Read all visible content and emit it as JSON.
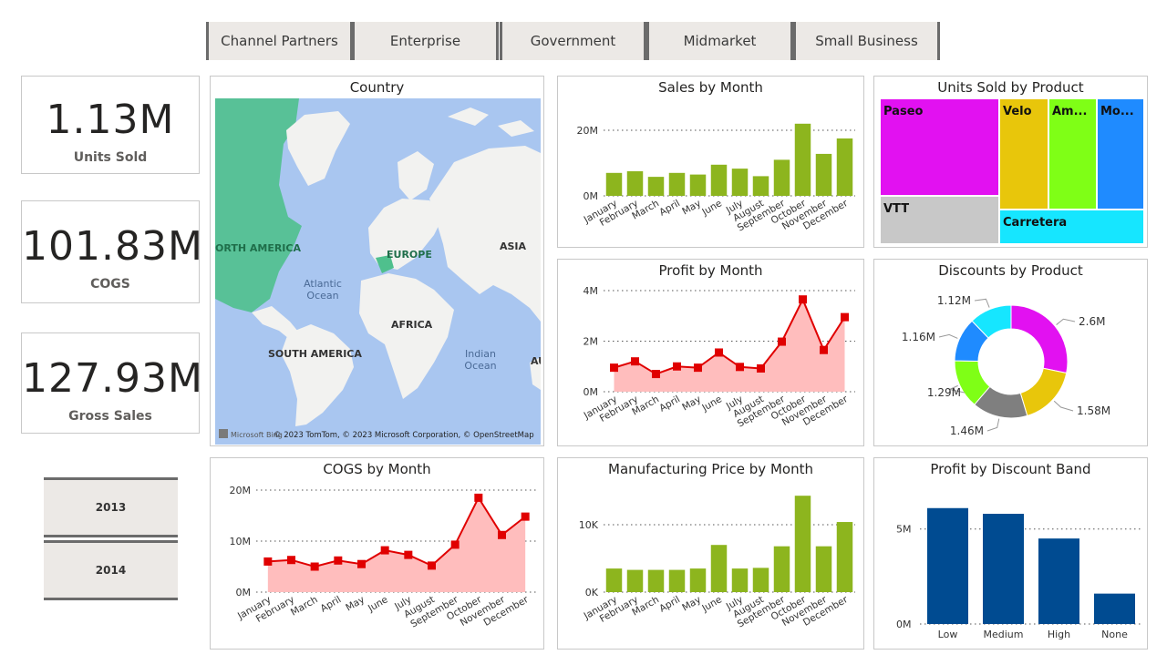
{
  "segments": [
    "Channel Partners",
    "Enterprise",
    "Government",
    "Midmarket",
    "Small Business"
  ],
  "kpis": [
    {
      "value": "1.13M",
      "label": "Units Sold"
    },
    {
      "value": "101.83M",
      "label": "COGS"
    },
    {
      "value": "127.93M",
      "label": "Gross Sales"
    }
  ],
  "years": [
    "2013",
    "2014"
  ],
  "map": {
    "title": "Country",
    "labels": {
      "north_america": "ORTH AMERICA",
      "europe": "EUROPE",
      "asia": "ASIA",
      "africa": "AFRICA",
      "south_america": "SOUTH AMERICA",
      "atlantic": "Atlantic\nOcean",
      "indian": "Indian\nOcean",
      "au": "AU"
    },
    "logo": "Microsoft Bing",
    "copyright": "© 2023 TomTom, © 2023 Microsoft Corporation, © OpenStreetMap",
    "colors": {
      "ocean": "#a9c6f0",
      "land": "#f2f2f0",
      "highlight": "#4fc08d"
    }
  },
  "months": [
    "January",
    "February",
    "March",
    "April",
    "May",
    "June",
    "July",
    "August",
    "September",
    "October",
    "November",
    "December"
  ],
  "chart_data": [
    {
      "type": "bar",
      "title": "Sales by Month",
      "color": "#8db51e",
      "yticks": [
        "0M",
        "20M"
      ],
      "ylim": [
        0,
        30
      ],
      "values": [
        7.0,
        7.5,
        5.8,
        7.0,
        6.5,
        9.5,
        8.3,
        6.0,
        11.0,
        22.0,
        12.8,
        17.5
      ]
    },
    {
      "type": "area",
      "title": "Profit by Month",
      "color": "#e00000",
      "fill": "#ffbdbd",
      "yticks": [
        "0M",
        "2M",
        "4M"
      ],
      "ylim": [
        0,
        4
      ],
      "values": [
        0.95,
        1.2,
        0.7,
        1.0,
        0.95,
        1.55,
        0.98,
        0.92,
        1.98,
        3.65,
        1.65,
        2.95
      ]
    },
    {
      "type": "area",
      "title": "COGS by Month",
      "color": "#e00000",
      "fill": "#ffbdbd",
      "yticks": [
        "0M",
        "10M",
        "20M"
      ],
      "ylim": [
        0,
        20
      ],
      "values": [
        6.0,
        6.3,
        5.0,
        6.2,
        5.5,
        8.2,
        7.3,
        5.2,
        9.3,
        18.5,
        11.2,
        14.8
      ]
    },
    {
      "type": "bar",
      "title": "Manufacturing Price by Month",
      "color": "#8db51e",
      "yticks": [
        "0K",
        "10K"
      ],
      "ylim": [
        0,
        15
      ],
      "values": [
        3.5,
        3.3,
        3.3,
        3.3,
        3.5,
        7.0,
        3.5,
        3.6,
        6.8,
        14.3,
        6.8,
        10.4
      ]
    },
    {
      "type": "treemap",
      "title": "Units Sold by Product",
      "items": [
        {
          "label": "Paseo",
          "color": "#e211f1"
        },
        {
          "label": "Velo",
          "color": "#e8c60b"
        },
        {
          "label": "Am...",
          "color": "#7fff16"
        },
        {
          "label": "Mo...",
          "color": "#1f8bff"
        },
        {
          "label": "VTT",
          "color": "#c8c8c8"
        },
        {
          "label": "Carretera",
          "color": "#16e6ff"
        }
      ]
    },
    {
      "type": "pie",
      "title": "Discounts by Product",
      "slices": [
        {
          "label": "2.6M",
          "value": 2.6,
          "color": "#e211f1"
        },
        {
          "label": "1.58M",
          "value": 1.58,
          "color": "#e8c60b"
        },
        {
          "label": "1.46M",
          "value": 1.46,
          "color": "#7f7f7f"
        },
        {
          "label": "1.29M",
          "value": 1.29,
          "color": "#7fff16"
        },
        {
          "label": "1.16M",
          "value": 1.16,
          "color": "#1f8bff"
        },
        {
          "label": "1.12M",
          "value": 1.12,
          "color": "#16e6ff"
        }
      ]
    },
    {
      "type": "bar",
      "title": "Profit by Discount Band",
      "color": "#004b91",
      "categories": [
        "Low",
        "Medium",
        "High",
        "None"
      ],
      "yticks": [
        "0M",
        "5M"
      ],
      "ylim": [
        0,
        7
      ],
      "values": [
        6.1,
        5.8,
        4.5,
        1.6
      ]
    }
  ]
}
